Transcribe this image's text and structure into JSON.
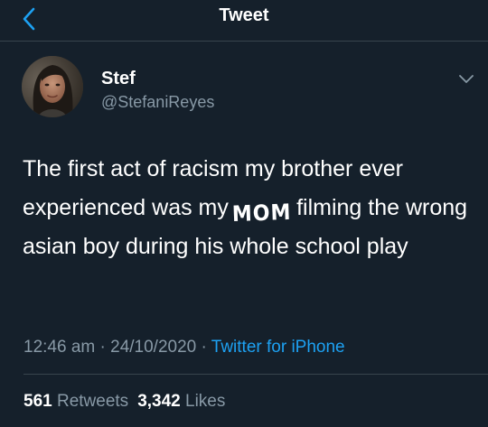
{
  "header": {
    "title": "Tweet",
    "back_icon": "chevron-left-icon"
  },
  "author": {
    "display_name": "Stef",
    "handle": "@StefaniReyes",
    "menu_icon": "chevron-down-icon"
  },
  "tweet": {
    "text_before": "The first act of racism my brother ever experienced was my",
    "emphasis_word": "MOM",
    "text_after": "filming the wrong asian boy during his whole school play"
  },
  "meta": {
    "time": "12:46 am",
    "separator": "·",
    "date": "24/10/2020",
    "source": "Twitter for iPhone"
  },
  "stats": {
    "retweets_count": "561",
    "retweets_label": "Retweets",
    "likes_count": "3,342",
    "likes_label": "Likes"
  },
  "colors": {
    "background": "#15202b",
    "secondary_text": "#8899a6",
    "accent": "#1da1f2",
    "divider": "#38444d"
  }
}
